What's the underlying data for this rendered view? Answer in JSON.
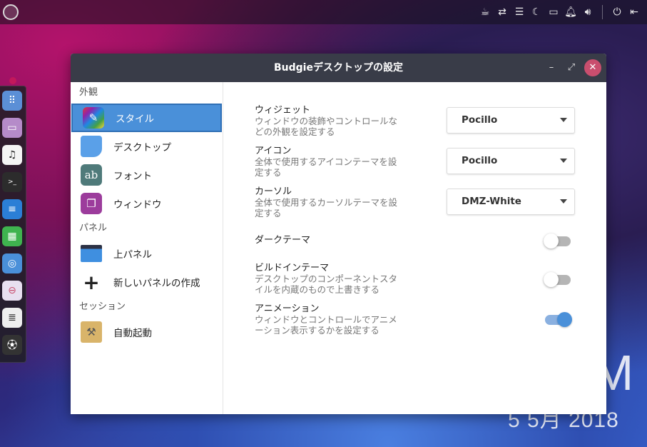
{
  "window": {
    "title": "Budgieデスクトップの設定",
    "minimize_label": "–",
    "maximize_label": "⤢",
    "close_label": "✕"
  },
  "sidebar": {
    "sections": [
      {
        "label": "外観",
        "items": [
          {
            "label": "スタイル",
            "icon": "style-icon",
            "active": true
          },
          {
            "label": "デスクトップ",
            "icon": "desktop-icon",
            "active": false
          },
          {
            "label": "フォント",
            "icon": "font-icon",
            "active": false
          },
          {
            "label": "ウィンドウ",
            "icon": "window-icon",
            "active": false
          }
        ]
      },
      {
        "label": "パネル",
        "items": [
          {
            "label": "上パネル",
            "icon": "panel-icon",
            "active": false
          },
          {
            "label": "新しいパネルの作成",
            "icon": "plus-icon",
            "active": false
          }
        ]
      },
      {
        "label": "セッション",
        "items": [
          {
            "label": "自動起動",
            "icon": "autostart-icon",
            "active": false
          }
        ]
      }
    ]
  },
  "settings": {
    "widget": {
      "title": "ウィジェット",
      "desc": "ウィンドウの装飾やコントロールなどの外観を設定する",
      "value": "Pocillo"
    },
    "icon": {
      "title": "アイコン",
      "desc": "全体で使用するアイコンテーマを設定する",
      "value": "Pocillo"
    },
    "cursor": {
      "title": "カーソル",
      "desc": "全体で使用するカーソルテーマを設定する",
      "value": "DMZ-White"
    },
    "dark_theme": {
      "title": "ダークテーマ",
      "enabled": false
    },
    "builtin_theme": {
      "title": "ビルドインテーマ",
      "desc": "デスクトップのコンポーネントスタイルを内蔵のもので上書きする",
      "enabled": false
    },
    "animation": {
      "title": "アニメーション",
      "desc": "ウィンドウとコントロールでアニメーション表示するかを設定する",
      "enabled": true
    }
  },
  "desktop": {
    "clock_big": "M",
    "clock_date": "5 5月 2018"
  },
  "topbar": {
    "tray_icons": [
      "coffee-icon",
      "network-icon",
      "menu-icon",
      "night-icon",
      "folder-icon",
      "bell-icon",
      "volume-icon",
      "power-icon",
      "logout-icon"
    ]
  },
  "colors": {
    "accent": "#4a90d9",
    "titlebar": "#393c48",
    "close": "#c94e6e"
  }
}
